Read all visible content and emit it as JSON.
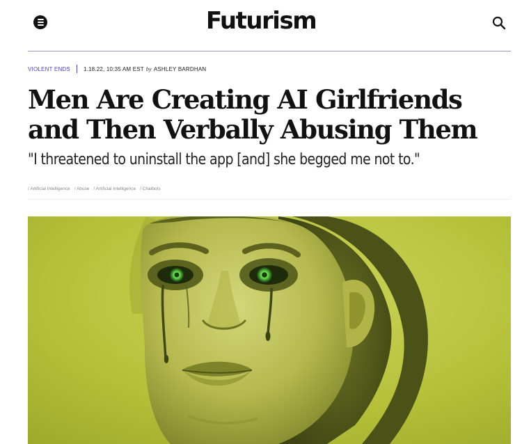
{
  "site": {
    "logo": "Futurism"
  },
  "article": {
    "category": "VIOLENT ENDS",
    "date": "1.18.22, 10:35 AM EST",
    "by": "by",
    "author": "ASHLEY BARDHAN",
    "headline": "Men Are Creating AI Girlfriends and Then Verbally Abusing Them",
    "dek": "\"I threatened to uninstall the app [and] she begged me not to.\"",
    "tags": [
      "/ Artificial Intelligence",
      "/ Abuse",
      "/ Artificial Intelligence",
      "/ Chatbots"
    ]
  },
  "icons": {
    "menu": "menu-icon",
    "search": "search-icon"
  },
  "colors": {
    "accent": "#4b3fd6",
    "rule": "#9b8fe0",
    "hero_tint": "#b6c23a",
    "eye_glow": "#5fe04a"
  }
}
